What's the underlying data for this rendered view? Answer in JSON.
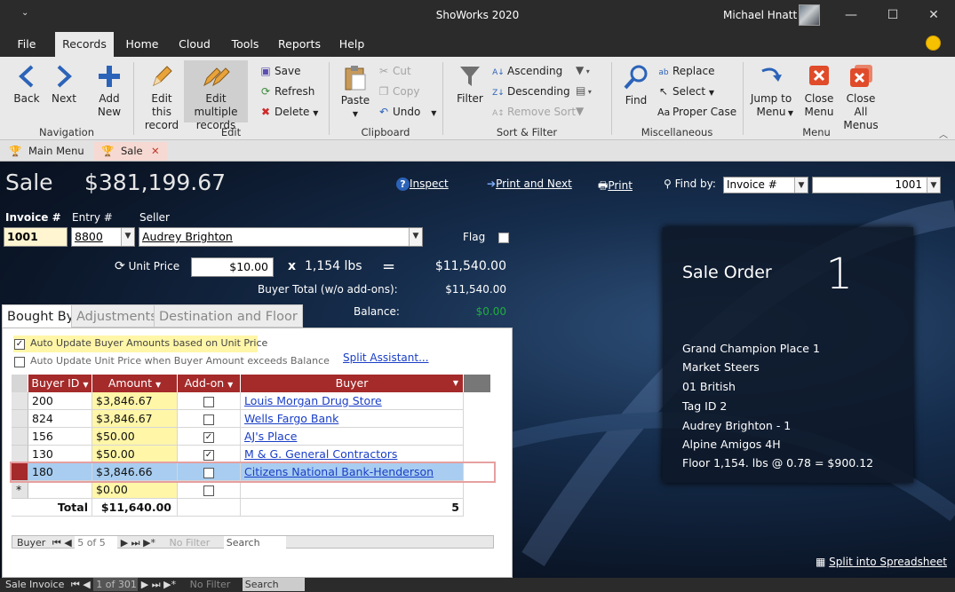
{
  "window": {
    "title": "ShoWorks 2020",
    "qat": "⌄",
    "user": "Michael Hnatt",
    "min": "—",
    "max": "☐",
    "close": "✕"
  },
  "ribbon_tabs": [
    "File",
    "Records",
    "Home",
    "Cloud",
    "Tools",
    "Reports",
    "Help"
  ],
  "ribbon": {
    "navigation": {
      "back": "Back",
      "next": "Next",
      "group": "Navigation"
    },
    "edit": {
      "add": "Add New",
      "edit_this": "Edit this record",
      "edit_multiple": "Edit multiple records",
      "save": "Save",
      "refresh": "Refresh",
      "delete": "Delete",
      "group": "Edit"
    },
    "clipboard": {
      "paste": "Paste",
      "cut": "Cut",
      "copy": "Copy",
      "undo": "Undo",
      "group": "Clipboard"
    },
    "sort": {
      "filter": "Filter",
      "ascending": "Ascending",
      "descending": "Descending",
      "remove_sort": "Remove Sort",
      "group": "Sort & Filter"
    },
    "misc": {
      "find": "Find",
      "replace": "Replace",
      "select": "Select",
      "proper_case": "Proper Case",
      "group": "Miscellaneous"
    },
    "menu": {
      "jump": "Jump to Menu",
      "close_menu": "Close Menu",
      "close_all": "Close All Menus",
      "group": "Menu"
    }
  },
  "doc_tabs": [
    "Main Menu",
    "Sale"
  ],
  "header": {
    "title": "Sale",
    "amount": "$381,199.67",
    "inspect": "Inspect",
    "print_next": "Print and Next",
    "print": "Print",
    "find_by_label": "Find by:",
    "find_by_value": "Invoice #",
    "find_value": "1001"
  },
  "form": {
    "invoice_label": "Invoice #",
    "invoice": "1001",
    "entry_label": "Entry #",
    "entry": "8800",
    "seller_label": "Seller",
    "seller": "Audrey Brighton",
    "flag_label": "Flag",
    "unit_price_label": "Unit Price",
    "unit_price": "$10.00",
    "times": "x",
    "weight": "1,154 lbs",
    "equals": "=",
    "total": "$11,540.00",
    "buyer_total_label": "Buyer Total (w/o add-ons):",
    "buyer_total": "$11,540.00",
    "balance_label": "Balance:",
    "balance": "$0.00"
  },
  "subtabs": [
    "Bought By",
    "Adjustments",
    "Destination and Floor"
  ],
  "options": {
    "auto_update_amounts": "Auto Update Buyer Amounts based on Unit Price",
    "auto_update_price": "Auto Update Unit Price when Buyer Amount exceeds Balance",
    "split_assistant": "Split Assistant..."
  },
  "grid": {
    "columns": [
      "Buyer ID",
      "Amount",
      "Add-on",
      "Buyer"
    ],
    "rows": [
      {
        "id": "200",
        "amount": "$3,846.67",
        "addon": false,
        "buyer": "Louis Morgan Drug Store"
      },
      {
        "id": "824",
        "amount": "$3,846.67",
        "addon": false,
        "buyer": "Wells Fargo Bank"
      },
      {
        "id": "156",
        "amount": "$50.00",
        "addon": true,
        "buyer": "AJ's Place"
      },
      {
        "id": "130",
        "amount": "$50.00",
        "addon": true,
        "buyer": "M & G. General Contractors"
      },
      {
        "id": "180",
        "amount": "$3,846.66",
        "addon": false,
        "buyer": "Citizens National Bank-Henderson"
      }
    ],
    "new_row_marker": "*",
    "new_amount": "$0.00",
    "total_label": "Total",
    "total_amount": "$11,640.00",
    "total_count": "5"
  },
  "grid_nav": {
    "label": "Buyer",
    "record": "5 of 5",
    "no_filter": "No Filter",
    "search": "Search"
  },
  "order": {
    "title": "Sale Order",
    "number": "1",
    "lines": [
      "Grand Champion  Place 1",
      "Market Steers",
      "01  British",
      "Tag ID 2",
      "Audrey Brighton  - 1",
      "Alpine Amigos 4H",
      "Floor 1,154. lbs @ 0.78 = $900.12"
    ]
  },
  "split_spreadsheet": "Split into Spreadsheet",
  "status": {
    "label": "Sale Invoice",
    "record": "1 of 301",
    "no_filter": "No Filter",
    "search": "Search"
  },
  "colors": {
    "accent": "#a52a2a",
    "highlight": "#ffef9e",
    "balance": "#1fae3e"
  }
}
